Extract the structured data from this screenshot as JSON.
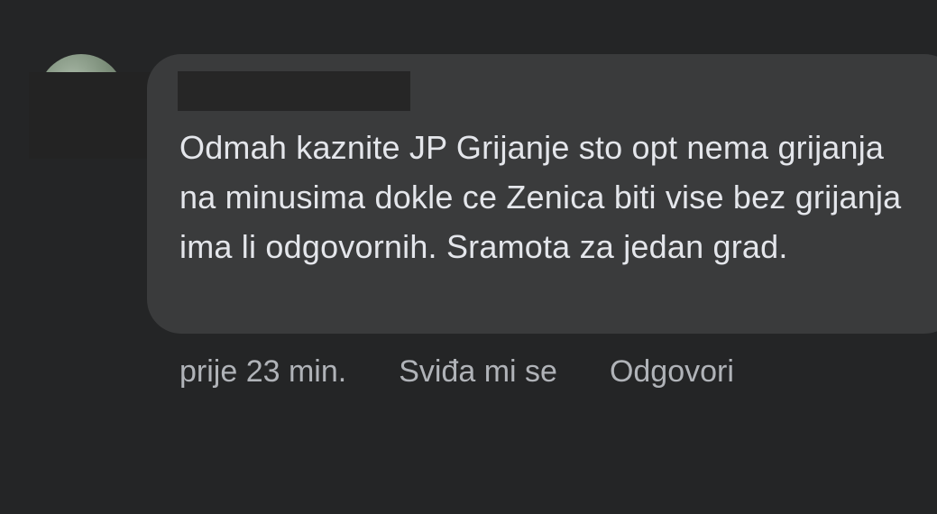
{
  "comment": {
    "author_name": "",
    "text": "Odmah kaznite JP Grijanje sto opt nema grijanja na minusima dokle ce Zenica biti vise bez grijanja ima li odgovornih. Sramota za jedan grad.",
    "timestamp": "prije 23 min.",
    "like_label": "Sviđa mi se",
    "reply_label": "Odgovori"
  },
  "colors": {
    "background": "#242526",
    "bubble": "#3a3b3c",
    "text": "#e4e6eb",
    "secondary_text": "#b0b3b8",
    "redaction": "#262626"
  }
}
